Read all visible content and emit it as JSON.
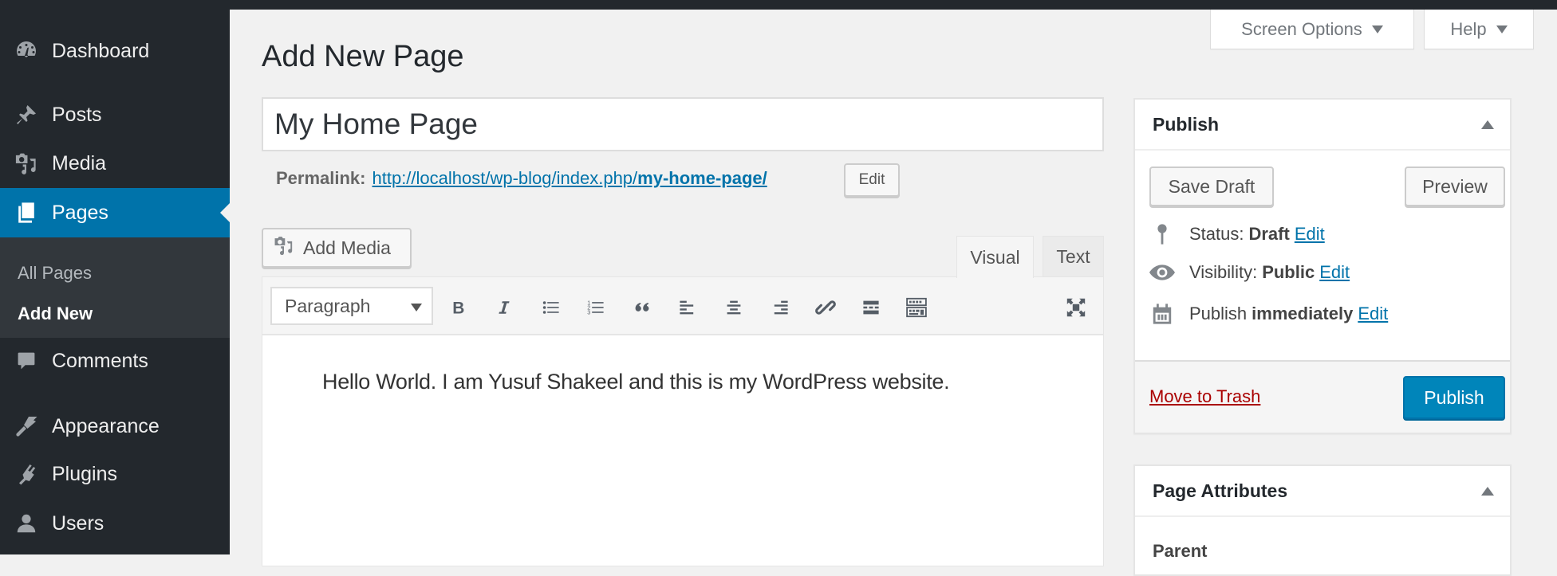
{
  "sidebar": {
    "items": [
      {
        "label": "Dashboard",
        "icon": "dashboard-icon"
      },
      {
        "label": "Posts",
        "icon": "pushpin-icon"
      },
      {
        "label": "Media",
        "icon": "media-icon"
      },
      {
        "label": "Pages",
        "icon": "pages-icon",
        "current": true
      },
      {
        "label": "Comments",
        "icon": "comment-icon"
      },
      {
        "label": "Appearance",
        "icon": "paintbrush-icon"
      },
      {
        "label": "Plugins",
        "icon": "plugin-icon"
      },
      {
        "label": "Users",
        "icon": "user-icon"
      }
    ],
    "submenu": [
      {
        "label": "All Pages"
      },
      {
        "label": "Add New",
        "current": true
      }
    ]
  },
  "header": {
    "screen_options": "Screen Options",
    "help": "Help",
    "page_title": "Add New Page"
  },
  "editor": {
    "title_value": "My Home Page",
    "permalink_label": "Permalink:",
    "permalink_base": "http://localhost/wp-blog/index.php/",
    "permalink_slug": "my-home-page/",
    "permalink_edit": "Edit",
    "add_media": "Add Media",
    "tabs": {
      "visual": "Visual",
      "text": "Text"
    },
    "format_select": "Paragraph",
    "toolbar": [
      "bold",
      "italic",
      "bulleted-list",
      "numbered-list",
      "blockquote",
      "align-left",
      "align-center",
      "align-right",
      "insert-link",
      "read-more",
      "toolbar-toggle",
      "fullscreen"
    ],
    "content": "Hello World. I am Yusuf Shakeel and this is my WordPress website."
  },
  "publish": {
    "title": "Publish",
    "save_draft": "Save Draft",
    "preview": "Preview",
    "status_label": "Status:",
    "status_value": "Draft",
    "visibility_label": "Visibility:",
    "visibility_value": "Public",
    "schedule_label": "Publish",
    "schedule_value": "immediately",
    "edit": "Edit",
    "move_to_trash": "Move to Trash",
    "publish_button": "Publish"
  },
  "page_attributes": {
    "title": "Page Attributes",
    "parent_label": "Parent"
  },
  "colors": {
    "admin_dark": "#23282d",
    "submenu_bg": "#32373c",
    "accent": "#0073aa",
    "publish_button": "#0085ba",
    "trash_red": "#a00"
  }
}
